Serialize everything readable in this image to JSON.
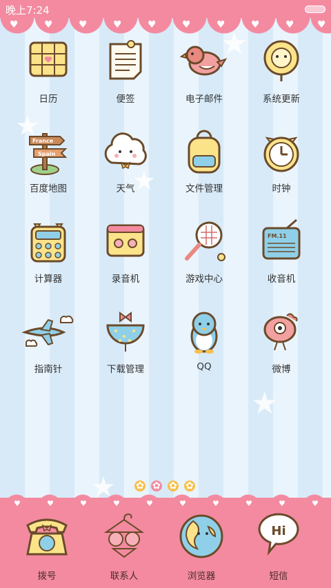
{
  "status_bar": {
    "time": "晚上7:24"
  },
  "apps": [
    {
      "label": "日历",
      "icon": "calendar-icon"
    },
    {
      "label": "便签",
      "icon": "notepad-icon"
    },
    {
      "label": "电子邮件",
      "icon": "bird-icon"
    },
    {
      "label": "系统更新",
      "icon": "lollipop-icon"
    },
    {
      "label": "百度地图",
      "icon": "signpost-icon"
    },
    {
      "label": "天气",
      "icon": "cloud-icon"
    },
    {
      "label": "文件管理",
      "icon": "backpack-icon"
    },
    {
      "label": "时钟",
      "icon": "clock-icon"
    },
    {
      "label": "计算器",
      "icon": "calculator-icon"
    },
    {
      "label": "录音机",
      "icon": "cassette-icon"
    },
    {
      "label": "游戏中心",
      "icon": "racket-icon"
    },
    {
      "label": "收音机",
      "icon": "radio-icon"
    },
    {
      "label": "指南针",
      "icon": "airplane-icon"
    },
    {
      "label": "下载管理",
      "icon": "balloon-icon"
    },
    {
      "label": "QQ",
      "icon": "penguin-icon"
    },
    {
      "label": "微博",
      "icon": "eye-bird-icon"
    }
  ],
  "signpost": {
    "top": "France",
    "bottom": "Spain"
  },
  "radio_text": "FM.11",
  "page_indicator": {
    "pages": 4,
    "current": 2
  },
  "dock": [
    {
      "label": "拨号",
      "icon": "telephone-icon"
    },
    {
      "label": "联系人",
      "icon": "hanger-icon"
    },
    {
      "label": "浏览器",
      "icon": "globe-icon"
    },
    {
      "label": "短信",
      "icon": "speech-bubble-icon"
    }
  ],
  "sms_text": "Hi",
  "colors": {
    "accent": "#f38aa0",
    "outline": "#6b4a2a",
    "yellow": "#fbe38a",
    "blue": "#8fd0e8"
  }
}
